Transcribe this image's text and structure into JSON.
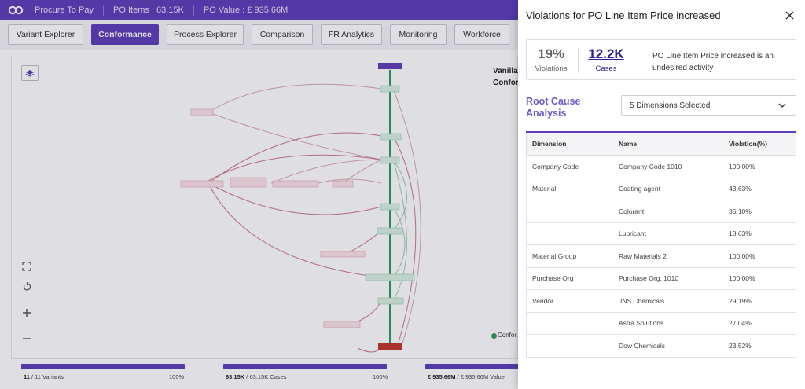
{
  "header": {
    "app_title": "Procure To Pay",
    "po_items": "PO Items : 63.15K",
    "po_value": "PO Value : £ 935.66M"
  },
  "tabs": [
    {
      "label": "Variant Explorer"
    },
    {
      "label": "Conformance"
    },
    {
      "label": "Process Explorer"
    },
    {
      "label": "Comparison"
    },
    {
      "label": "FR Analytics"
    },
    {
      "label": "Monitoring"
    },
    {
      "label": "Workforce"
    }
  ],
  "canvas": {
    "title_line1": "Vanilla",
    "title_line2": "Confor",
    "legend_label": "Confor"
  },
  "stats": [
    {
      "strong": "11",
      "text": " / 11 Variants",
      "pct": "100%"
    },
    {
      "strong": "63.15K",
      "text": " / 63.15K Cases",
      "pct": "100%"
    },
    {
      "strong": "£ 935.66M",
      "text": " / £ 935.66M Value",
      "pct": ""
    }
  ],
  "panel": {
    "title": "Violations for PO Line Item Price increased",
    "violations_value": "19%",
    "violations_label": "Violations",
    "cases_value": "12.2K",
    "cases_label": "Cases",
    "description": "PO Line Item Price increased is an undesired activity",
    "rca_title": "Root Cause Analysis",
    "dimensions_selected": "5 Dimensions Selected",
    "accent_color": "#5b3fb8",
    "table": {
      "headers": [
        "Dimension",
        "Name",
        "Violation(%)"
      ],
      "rows": [
        {
          "dimension": "Company Code",
          "name": "Company Code 1010",
          "violation": "100.00%"
        },
        {
          "dimension": "Material",
          "name": "Coating agent",
          "violation": "43.63%"
        },
        {
          "dimension": "",
          "name": "Colorant",
          "violation": "35.10%"
        },
        {
          "dimension": "",
          "name": "Lubricant",
          "violation": "18.63%"
        },
        {
          "dimension": "Material Group",
          "name": "Raw Materials 2",
          "violation": "100.00%"
        },
        {
          "dimension": "Purchase Org",
          "name": "Purchase Org. 1010",
          "violation": "100.00%"
        },
        {
          "dimension": "Vendor",
          "name": "JNS Chemicals",
          "violation": "29.19%"
        },
        {
          "dimension": "",
          "name": "Astra Solutions",
          "violation": "27.04%"
        },
        {
          "dimension": "",
          "name": "Dow Chemicals",
          "violation": "23.52%"
        }
      ]
    }
  }
}
